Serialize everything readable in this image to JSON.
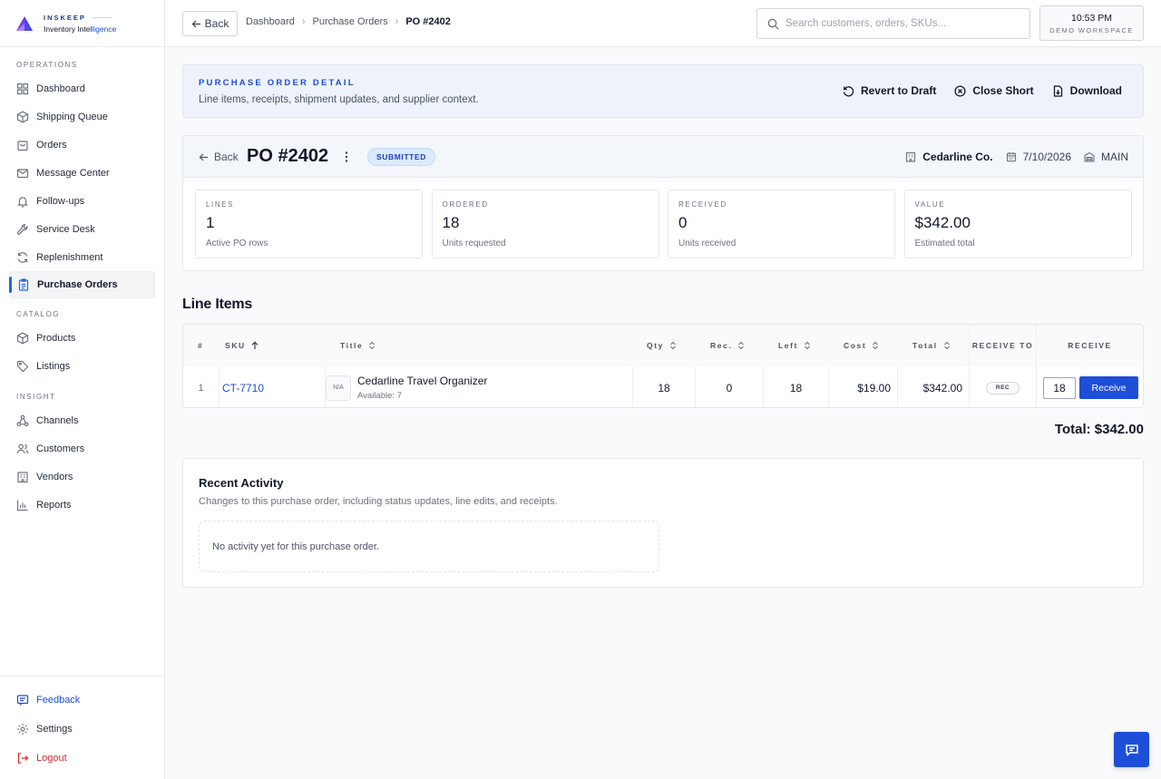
{
  "brand": {
    "name": "INSKEEP",
    "subtitle_a": "Inventory Intel",
    "subtitle_b": "ligence"
  },
  "sidebar": {
    "sections": [
      {
        "label": "OPERATIONS",
        "items": [
          {
            "label": "Dashboard",
            "icon": "grid-icon"
          },
          {
            "label": "Shipping Queue",
            "icon": "package-icon"
          },
          {
            "label": "Orders",
            "icon": "bag-icon"
          },
          {
            "label": "Message Center",
            "icon": "mail-icon"
          },
          {
            "label": "Follow-ups",
            "icon": "bell-icon"
          },
          {
            "label": "Service Desk",
            "icon": "wrench-icon"
          },
          {
            "label": "Replenishment",
            "icon": "refresh-icon"
          },
          {
            "label": "Purchase Orders",
            "icon": "clipboard-icon",
            "active": true
          }
        ]
      },
      {
        "label": "CATALOG",
        "items": [
          {
            "label": "Products",
            "icon": "cube-icon"
          },
          {
            "label": "Listings",
            "icon": "tag-icon"
          }
        ]
      },
      {
        "label": "INSIGHT",
        "items": [
          {
            "label": "Channels",
            "icon": "network-icon"
          },
          {
            "label": "Customers",
            "icon": "users-icon"
          },
          {
            "label": "Vendors",
            "icon": "building-icon"
          },
          {
            "label": "Reports",
            "icon": "bar-chart-icon"
          }
        ]
      }
    ],
    "bottom": {
      "feedback": "Feedback",
      "settings": "Settings",
      "logout": "Logout"
    }
  },
  "topbar": {
    "back": "Back",
    "breadcrumb": [
      "Dashboard",
      "Purchase Orders",
      "PO #2402"
    ],
    "search_placeholder": "Search customers, orders, SKUs...",
    "time": "10:53 PM",
    "workspace": "DEMO WORKSPACE"
  },
  "header": {
    "eyebrow": "PURCHASE ORDER DETAIL",
    "subtitle": "Line items, receipts, shipment updates, and supplier context.",
    "actions": {
      "revert": "Revert to Draft",
      "close_short": "Close Short",
      "download": "Download"
    }
  },
  "po": {
    "back": "Back",
    "title": "PO #2402",
    "status": "SUBMITTED",
    "vendor": "Cedarline Co.",
    "date": "7/10/2026",
    "location": "MAIN",
    "stats": [
      {
        "label": "LINES",
        "value": "1",
        "sub": "Active PO rows"
      },
      {
        "label": "ORDERED",
        "value": "18",
        "sub": "Units requested"
      },
      {
        "label": "RECEIVED",
        "value": "0",
        "sub": "Units received"
      },
      {
        "label": "VALUE",
        "value": "$342.00",
        "sub": "Estimated total"
      }
    ]
  },
  "line_items": {
    "title": "Line Items",
    "columns": {
      "num": "#",
      "sku": "SKU",
      "title": "Title",
      "qty": "Qty",
      "rec": "Rec.",
      "left": "Left",
      "cost": "Cost",
      "total": "Total",
      "receive_to": "RECEIVE TO",
      "receive": "RECEIVE"
    },
    "rows": [
      {
        "num": "1",
        "sku": "CT-7710",
        "thumb": "N/A",
        "title": "Cedarline Travel Organizer",
        "available": "Available: 7",
        "qty": "18",
        "rec": "0",
        "left": "18",
        "cost": "$19.00",
        "total": "$342.00",
        "receive_to": "REC",
        "receive_qty": "18",
        "receive_btn": "Receive"
      }
    ],
    "grand_total": "Total: $342.00"
  },
  "activity": {
    "title": "Recent Activity",
    "subtitle": "Changes to this purchase order, including status updates, line edits, and receipts.",
    "empty": "No activity yet for this purchase order."
  }
}
